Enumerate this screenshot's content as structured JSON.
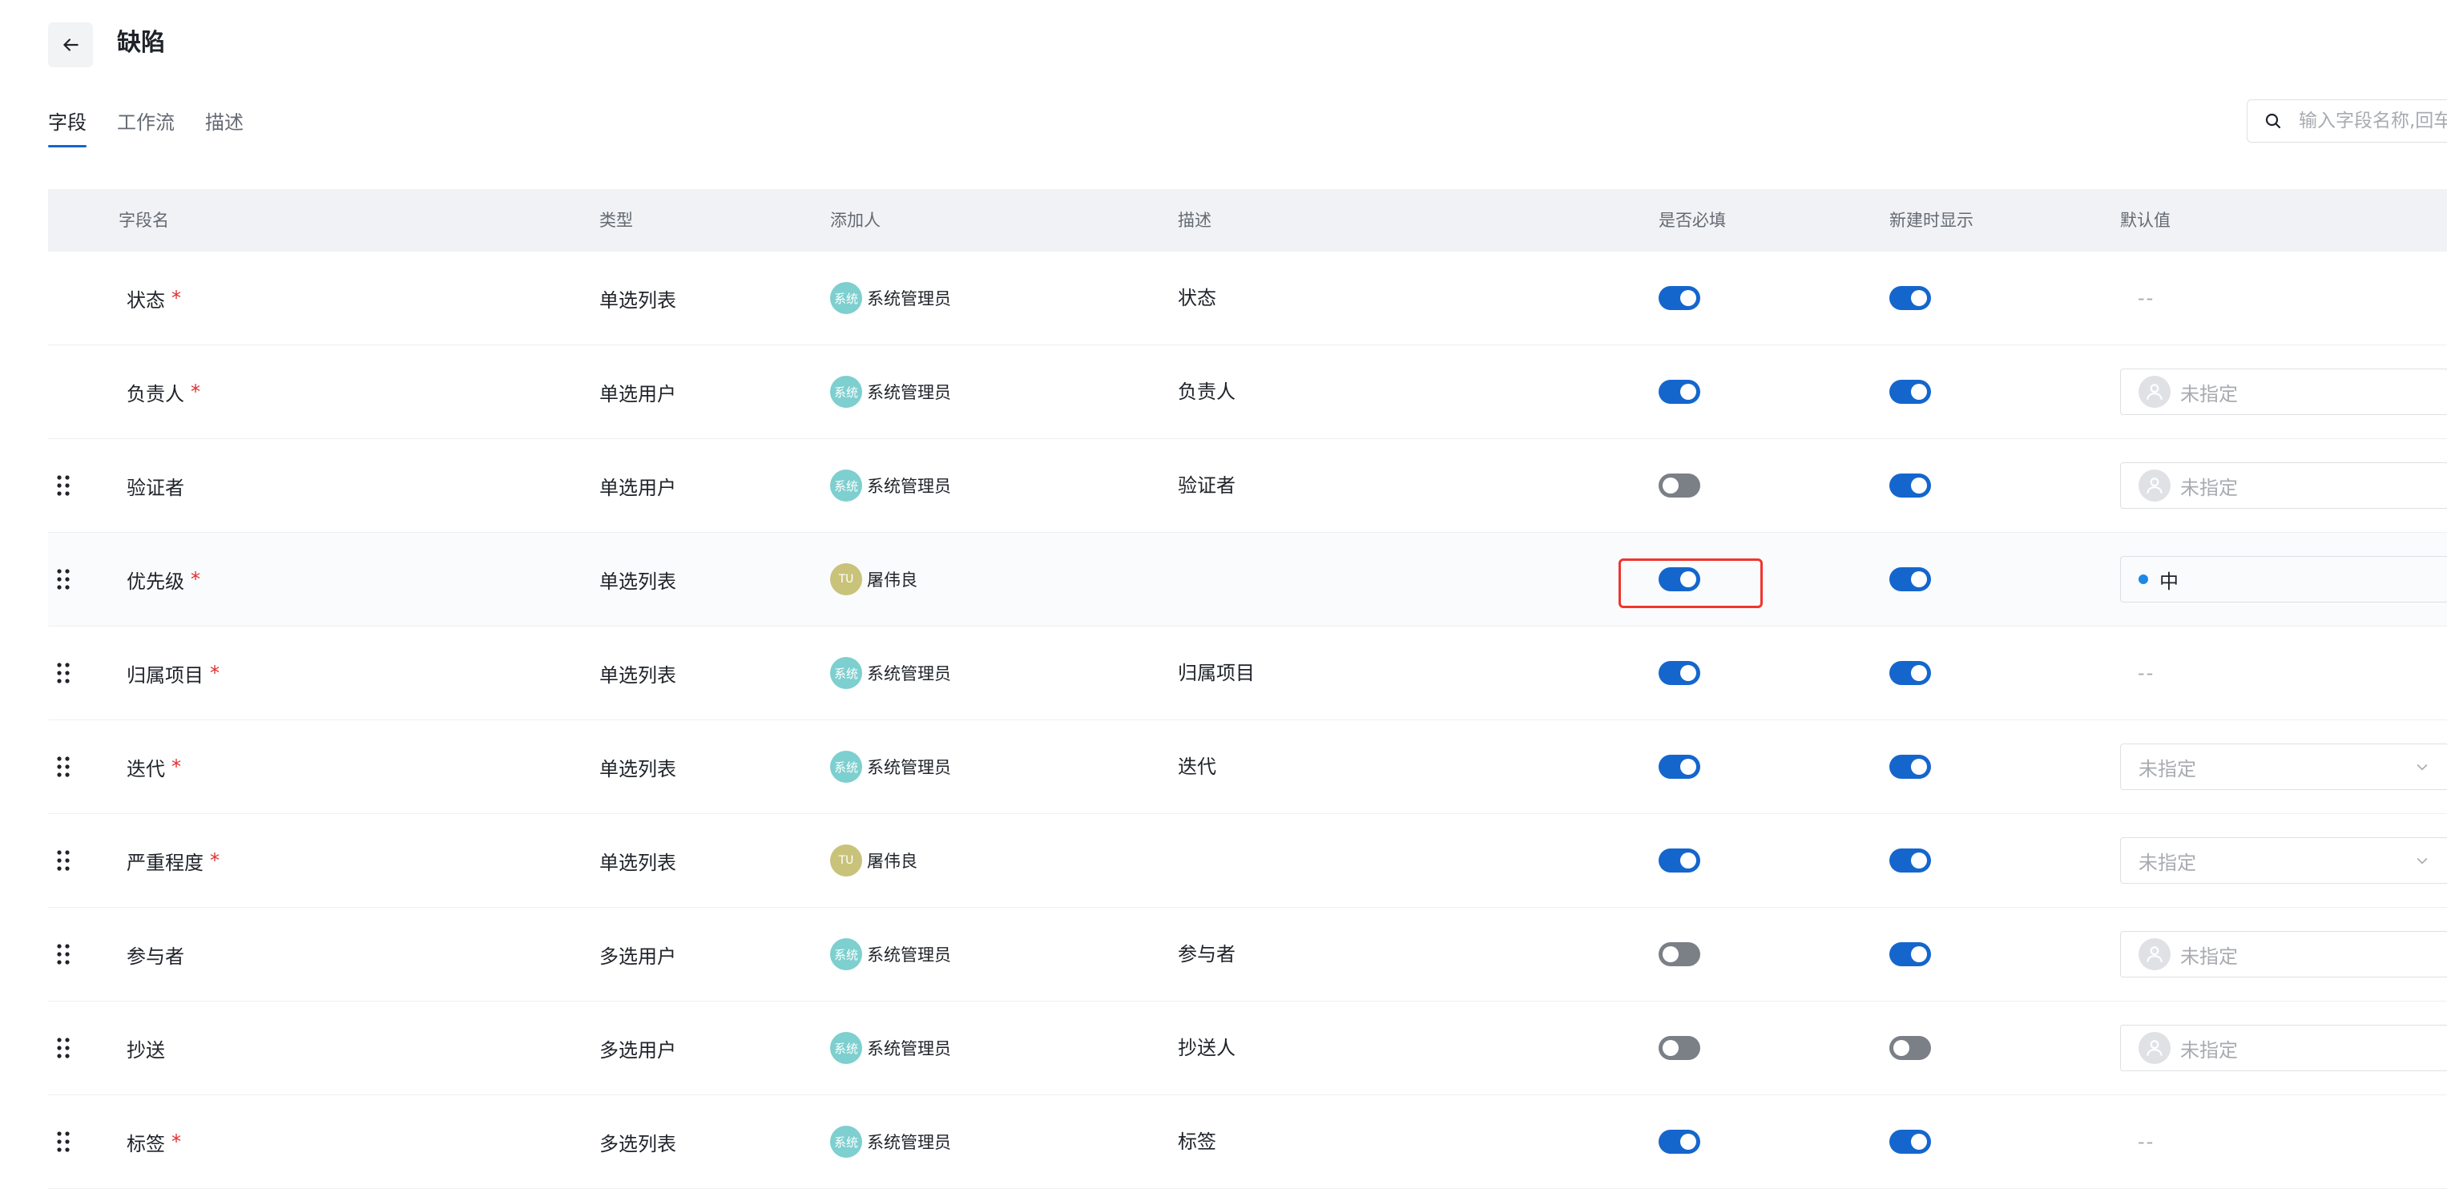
{
  "header": {
    "back_label": "←",
    "title": "缺陷"
  },
  "tabs": [
    {
      "label": "字段",
      "active": true
    },
    {
      "label": "工作流",
      "active": false
    },
    {
      "label": "描述",
      "active": false
    }
  ],
  "search": {
    "placeholder": "输入字段名称,回车"
  },
  "table": {
    "columns": [
      "字段名",
      "类型",
      "添加人",
      "描述",
      "是否必填",
      "新建时显示",
      "默认值"
    ],
    "rows": [
      {
        "name": "状态",
        "required_mark": "*",
        "draggable": false,
        "type": "单选列表",
        "adder_avatar": "系统",
        "adder": "系统管理员",
        "description": "状态",
        "required": true,
        "show_on_create": true,
        "default_kind": "dash",
        "default_text": "--"
      },
      {
        "name": "负责人",
        "required_mark": "*",
        "draggable": false,
        "type": "单选用户",
        "adder_avatar": "系统",
        "adder": "系统管理员",
        "description": "负责人",
        "required": true,
        "show_on_create": true,
        "default_kind": "user",
        "default_text": "未指定"
      },
      {
        "name": "验证者",
        "required_mark": "",
        "draggable": true,
        "type": "单选用户",
        "adder_avatar": "系统",
        "adder": "系统管理员",
        "description": "验证者",
        "required": false,
        "show_on_create": true,
        "default_kind": "user",
        "default_text": "未指定"
      },
      {
        "name": "优先级",
        "required_mark": "*",
        "draggable": true,
        "type": "单选列表",
        "adder_avatar": "TU",
        "adder": "屠伟良",
        "description": "",
        "required": true,
        "show_on_create": true,
        "default_kind": "option",
        "default_text": "中",
        "highlighted": true
      },
      {
        "name": "归属项目",
        "required_mark": "*",
        "draggable": true,
        "type": "单选列表",
        "adder_avatar": "系统",
        "adder": "系统管理员",
        "description": "归属项目",
        "required": true,
        "show_on_create": true,
        "default_kind": "dash",
        "default_text": "--"
      },
      {
        "name": "迭代",
        "required_mark": "*",
        "draggable": true,
        "type": "单选列表",
        "adder_avatar": "系统",
        "adder": "系统管理员",
        "description": "迭代",
        "required": true,
        "show_on_create": true,
        "default_kind": "select",
        "default_text": "未指定"
      },
      {
        "name": "严重程度",
        "required_mark": "*",
        "draggable": true,
        "type": "单选列表",
        "adder_avatar": "TU",
        "adder": "屠伟良",
        "description": "",
        "required": true,
        "show_on_create": true,
        "default_kind": "select",
        "default_text": "未指定"
      },
      {
        "name": "参与者",
        "required_mark": "",
        "draggable": true,
        "type": "多选用户",
        "adder_avatar": "系统",
        "adder": "系统管理员",
        "description": "参与者",
        "required": false,
        "show_on_create": true,
        "default_kind": "user",
        "default_text": "未指定"
      },
      {
        "name": "抄送",
        "required_mark": "",
        "draggable": true,
        "type": "多选用户",
        "adder_avatar": "系统",
        "adder": "系统管理员",
        "description": "抄送人",
        "required": false,
        "show_on_create": false,
        "default_kind": "user",
        "default_text": "未指定"
      },
      {
        "name": "标签",
        "required_mark": "*",
        "draggable": true,
        "type": "多选列表",
        "adder_avatar": "系统",
        "adder": "系统管理员",
        "description": "标签",
        "required": true,
        "show_on_create": true,
        "default_kind": "dash",
        "default_text": "--"
      }
    ]
  },
  "colors": {
    "accent": "#1466cc",
    "toggle_off": "#7b7f86",
    "required_mark": "#e02f2f",
    "highlight": "#f0362d",
    "option_dot": "#1e88e5"
  }
}
